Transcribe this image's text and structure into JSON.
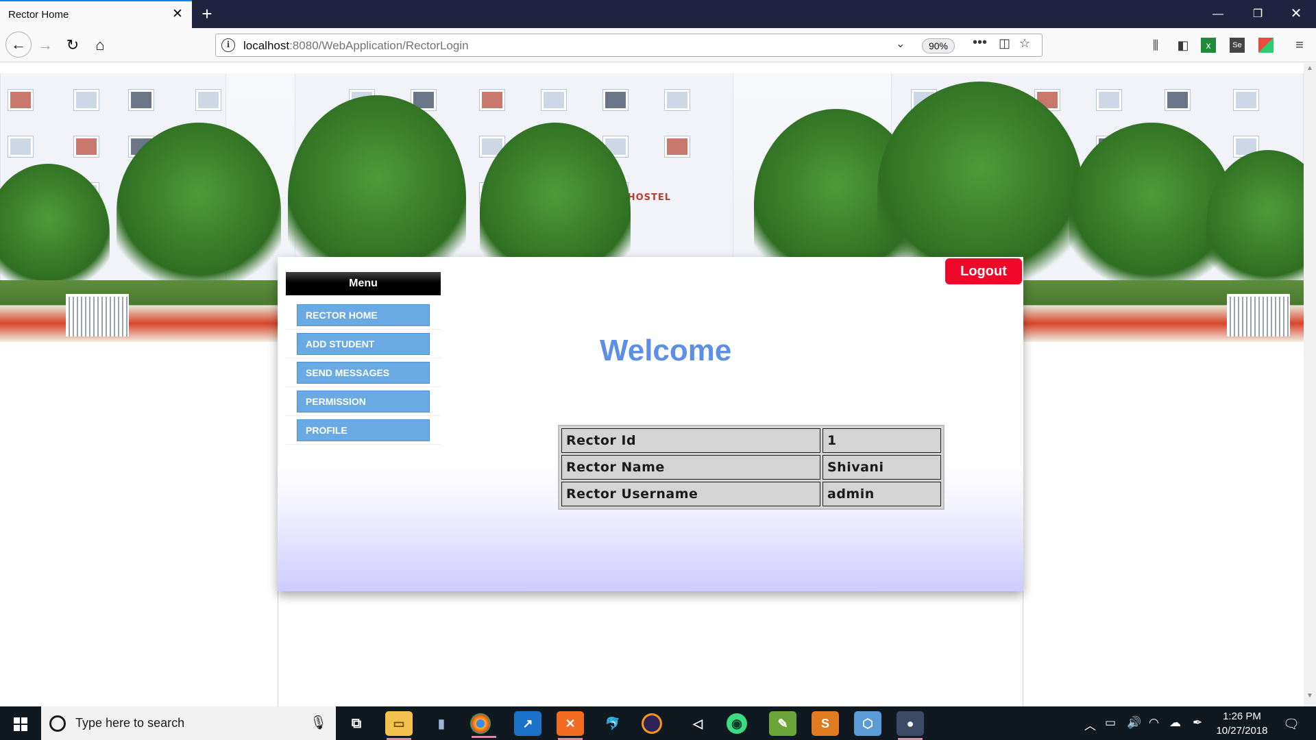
{
  "browser": {
    "tab_title": "Rector Home",
    "tab_close": "✕",
    "new_tab": "+",
    "url_host": "localhost",
    "url_path": ":8080/WebApplication/RectorLogin",
    "zoom": "90%"
  },
  "banner": {
    "sign_text": "GIRLS HOSTEL"
  },
  "menu": {
    "heading": "Menu",
    "items": [
      {
        "label": "RECTOR HOME"
      },
      {
        "label": "ADD STUDENT"
      },
      {
        "label": "SEND MESSAGES"
      },
      {
        "label": "PERMISSION"
      },
      {
        "label": "PROFILE"
      }
    ]
  },
  "header": {
    "logout_label": "Logout",
    "welcome": "Welcome"
  },
  "rector_info": {
    "rows": [
      {
        "label": "Rector Id",
        "value": "1"
      },
      {
        "label": "Rector Name",
        "value": "Shivani"
      },
      {
        "label": "Rector Username",
        "value": "admin"
      }
    ]
  },
  "taskbar": {
    "search_placeholder": "Type here to search",
    "time": "1:26 PM",
    "date": "10/27/2018"
  },
  "colors": {
    "menu_button": "#6aaae4",
    "logout": "#f0082a",
    "welcome": "#5e8fe6",
    "tabbar": "#202340"
  }
}
